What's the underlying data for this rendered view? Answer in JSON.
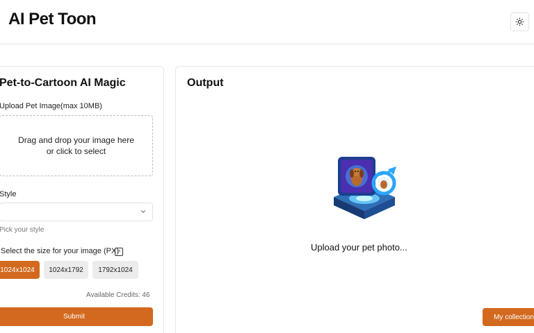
{
  "header": {
    "title": "AI Pet Toon",
    "theme_toggle_icon": "sun-icon"
  },
  "form": {
    "heading": "Pet-to-Cartoon AI Magic",
    "upload_label": "Upload Pet Image(max 10MB)",
    "dropzone_line1": "Drag and drop your image here",
    "dropzone_line2": "or click to select",
    "style_label": "Style",
    "style_value": "",
    "style_hint": "Pick your style",
    "size_label": "Select the size for your image (PX)",
    "sizes": [
      "1024x1024",
      "1024x1792",
      "1792x1024"
    ],
    "selected_size": "1024x1024",
    "credits": "Available Credits: 46",
    "submit_label": "Submit"
  },
  "output": {
    "heading": "Output",
    "placeholder": "Upload your pet photo...",
    "collection_label": "My collection"
  },
  "colors": {
    "accent": "#d2691e",
    "inactive_button": "#ececec",
    "border": "#e6e6e6"
  }
}
